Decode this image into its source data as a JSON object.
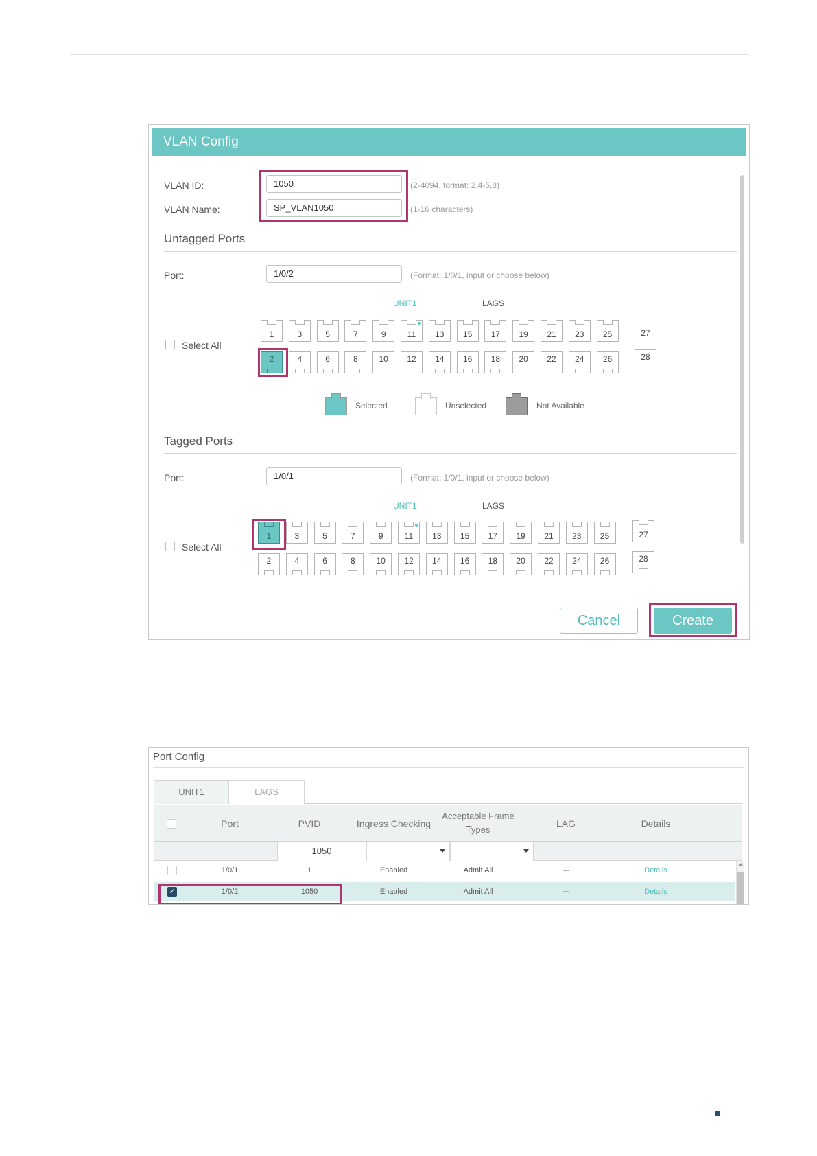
{
  "vlan_config": {
    "title": "VLAN Config",
    "vlan_id_label": "VLAN ID:",
    "vlan_id_value": "1050",
    "vlan_id_hint": "(2-4094, format: 2,4-5,8)",
    "vlan_name_label": "VLAN Name:",
    "vlan_name_value": "SP_VLAN1050",
    "vlan_name_hint": "(1-16 characters)",
    "untagged": {
      "section_title": "Untagged Ports",
      "port_label": "Port:",
      "port_value": "1/0/2",
      "port_hint": "(Format: 1/0/1, input or choose below)",
      "unit_title": "UNIT1",
      "lags_title": "LAGS",
      "select_all_label": "Select All",
      "top_ports": [
        "1",
        "3",
        "5",
        "7",
        "9",
        "11",
        "13",
        "15",
        "17",
        "19",
        "21",
        "23",
        "25"
      ],
      "bottom_ports": [
        "2",
        "4",
        "6",
        "8",
        "10",
        "12",
        "14",
        "16",
        "18",
        "20",
        "22",
        "24",
        "26"
      ],
      "lag_top": "27",
      "lag_bottom": "28",
      "selected_port": "2"
    },
    "legend": {
      "selected": "Selected",
      "unselected": "Unselected",
      "not_available": "Not Available"
    },
    "tagged": {
      "section_title": "Tagged Ports",
      "port_label": "Port:",
      "port_value": "1/0/1",
      "port_hint": "(Format: 1/0/1, input or choose below)",
      "unit_title": "UNIT1",
      "lags_title": "LAGS",
      "select_all_label": "Select All",
      "top_ports": [
        "1",
        "3",
        "5",
        "7",
        "9",
        "11",
        "13",
        "15",
        "17",
        "19",
        "21",
        "23",
        "25"
      ],
      "bottom_ports": [
        "2",
        "4",
        "6",
        "8",
        "10",
        "12",
        "14",
        "16",
        "18",
        "20",
        "22",
        "24",
        "26"
      ],
      "lag_top": "27",
      "lag_bottom": "28",
      "selected_port": "1"
    },
    "cancel_label": "Cancel",
    "create_label": "Create"
  },
  "port_config": {
    "title": "Port Config",
    "tabs": [
      "UNIT1",
      "LAGS"
    ],
    "headers": {
      "port": "Port",
      "pvid": "PVID",
      "ingress": "Ingress Checking",
      "frame_line1": "Acceptable Frame",
      "frame_line2": "Types",
      "lag": "LAG",
      "details": "Details"
    },
    "filter_pvid": "1050",
    "rows": [
      {
        "port": "1/0/1",
        "pvid": "1",
        "ingress": "Enabled",
        "frame": "Admit All",
        "lag": "---",
        "details": "Details",
        "checked": false
      },
      {
        "port": "1/0/2",
        "pvid": "1050",
        "ingress": "Enabled",
        "frame": "Admit All",
        "lag": "---",
        "details": "Details",
        "checked": true
      }
    ]
  },
  "colors": {
    "accent": "#6cc6c4",
    "highlight": "#b0346e",
    "link": "#4fbcba"
  }
}
